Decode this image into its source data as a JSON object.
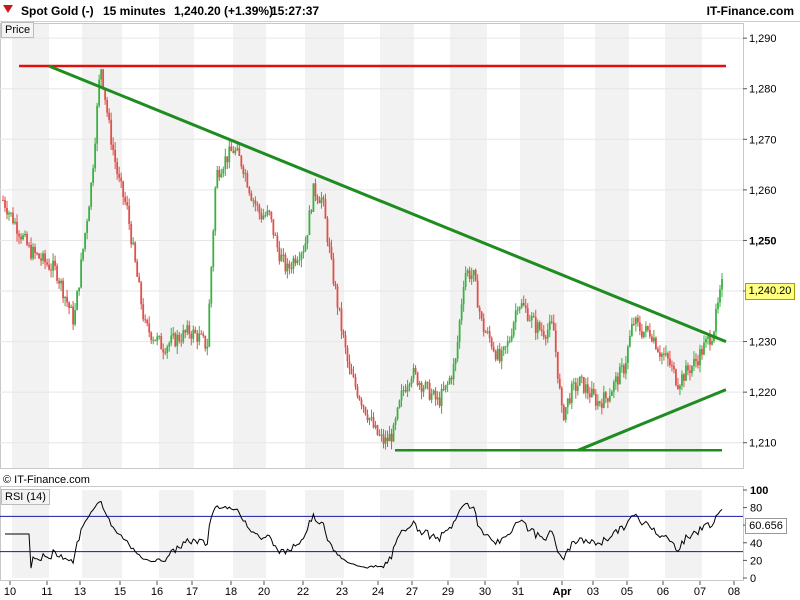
{
  "header": {
    "instrument": "Spot Gold (-)",
    "interval": "15 minutes",
    "quote": "1,240.20 (+1.39%)",
    "time": "15:27:37",
    "brand": "IT-Finance.com"
  },
  "price_panel": {
    "label": "Price",
    "copyright": "© IT-Finance.com",
    "last_price_label": "1,240.20",
    "current_tick_bold": "1,250"
  },
  "rsi_panel": {
    "label": "RSI (14)",
    "value_label": "60.656"
  },
  "colors": {
    "up": "#3cb043",
    "down": "#e0504a",
    "trendline": "#1f8c1f",
    "resistance": "#e01010",
    "rsi_line": "#000000",
    "rsi_band": "#1a1aa0"
  },
  "chart_data": [
    {
      "type": "candlestick",
      "ylim": [
        1205,
        1293
      ],
      "yticks": [
        "1,290",
        "1,280",
        "1,270",
        "1,260",
        "1,250",
        "1,240",
        "1,230",
        "1,220",
        "1,210"
      ],
      "ytick_values": [
        1290,
        1280,
        1270,
        1260,
        1250,
        1240,
        1230,
        1220,
        1210
      ],
      "xticks": [
        "10",
        "11",
        "13",
        "15",
        "16",
        "17",
        "18",
        "20",
        "22",
        "23",
        "24",
        "27",
        "29",
        "30",
        "31",
        "Apr",
        "03",
        "05",
        "06",
        "07",
        "08"
      ],
      "session_shading": "alternating grey/white day columns",
      "price_path": [
        [
          0,
          1258
        ],
        [
          3,
          1248
        ],
        [
          6,
          1244
        ],
        [
          8,
          1234
        ],
        [
          9,
          1248
        ],
        [
          10,
          1262
        ],
        [
          11,
          1285
        ],
        [
          12,
          1272
        ],
        [
          13,
          1262
        ],
        [
          14,
          1256
        ],
        [
          15,
          1244
        ],
        [
          16,
          1233
        ],
        [
          17,
          1231
        ],
        [
          18,
          1229
        ],
        [
          19,
          1230
        ],
        [
          21,
          1232
        ],
        [
          22,
          1231
        ],
        [
          23,
          1229
        ],
        [
          24,
          1263
        ],
        [
          25,
          1266
        ],
        [
          26,
          1268
        ],
        [
          27,
          1265
        ],
        [
          28,
          1259
        ],
        [
          29,
          1255
        ],
        [
          30,
          1255
        ],
        [
          31,
          1248
        ],
        [
          32,
          1244
        ],
        [
          33,
          1247
        ],
        [
          34,
          1249
        ],
        [
          35,
          1260
        ],
        [
          36,
          1258
        ],
        [
          37,
          1245
        ],
        [
          38,
          1234
        ],
        [
          39,
          1224
        ],
        [
          40,
          1220
        ],
        [
          41,
          1216
        ],
        [
          42,
          1212
        ],
        [
          43,
          1210
        ],
        [
          44,
          1212
        ],
        [
          45,
          1220
        ],
        [
          46,
          1224
        ],
        [
          47,
          1222
        ],
        [
          48,
          1220
        ],
        [
          49,
          1218
        ],
        [
          50,
          1221
        ],
        [
          51,
          1226
        ],
        [
          52,
          1244
        ],
        [
          53,
          1243
        ],
        [
          54,
          1233
        ],
        [
          55,
          1230
        ],
        [
          56,
          1226
        ],
        [
          57,
          1230
        ],
        [
          58,
          1238
        ],
        [
          59,
          1236
        ],
        [
          60,
          1233
        ],
        [
          61,
          1232
        ],
        [
          62,
          1233
        ],
        [
          63,
          1215
        ],
        [
          64,
          1220
        ],
        [
          65,
          1222
        ],
        [
          66,
          1220
        ],
        [
          67,
          1218
        ],
        [
          68,
          1219
        ],
        [
          69,
          1222
        ],
        [
          70,
          1225
        ],
        [
          71,
          1234
        ],
        [
          72,
          1232
        ],
        [
          73,
          1232
        ],
        [
          74,
          1228
        ],
        [
          75,
          1226
        ],
        [
          76,
          1222
        ],
        [
          77,
          1224
        ],
        [
          78,
          1226
        ],
        [
          79,
          1229
        ],
        [
          80,
          1232
        ],
        [
          81,
          1241
        ]
      ],
      "annotations": {
        "resistance_line": 1284.5,
        "support_line": 1208.5,
        "descending_trendline": [
          [
            1,
            1284.5
          ],
          [
            73,
            1230
          ]
        ],
        "ascending_trendline": [
          [
            64,
            1208.5
          ],
          [
            73,
            1220.5
          ]
        ]
      }
    },
    {
      "type": "line",
      "name": "RSI (14)",
      "ylim": [
        0,
        100
      ],
      "yticks": [
        "100",
        "80",
        "60",
        "40",
        "20",
        "0"
      ],
      "ytick_values": [
        100,
        80,
        60,
        40,
        20,
        0
      ],
      "bands": [
        70,
        30
      ],
      "last_value": 60.656
    }
  ]
}
